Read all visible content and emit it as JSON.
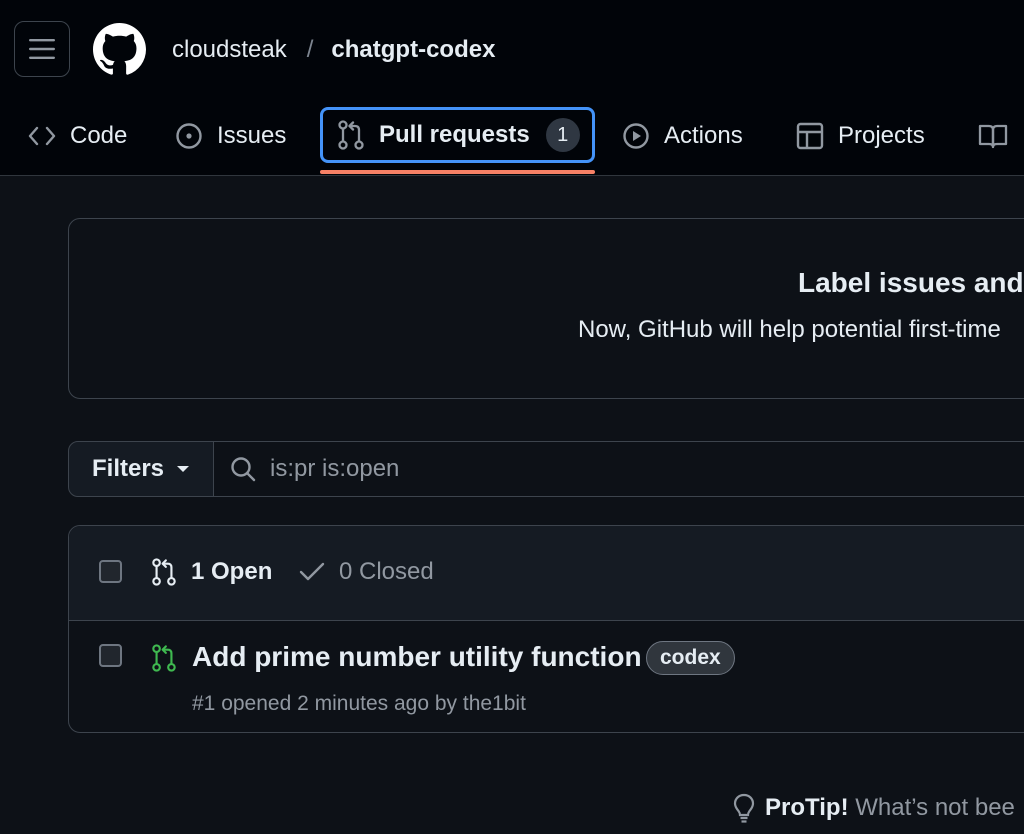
{
  "breadcrumb": {
    "owner": "cloudsteak",
    "separator": "/",
    "repo": "chatgpt-codex"
  },
  "tabs": [
    {
      "label": "Code",
      "icon": "code-icon"
    },
    {
      "label": "Issues",
      "icon": "issue-opened-icon"
    },
    {
      "label": "Pull requests",
      "icon": "git-pull-request-icon",
      "count": "1",
      "active": true
    },
    {
      "label": "Actions",
      "icon": "play-icon"
    },
    {
      "label": "Projects",
      "icon": "table-icon"
    },
    {
      "label": "",
      "icon": "book-icon"
    }
  ],
  "banner": {
    "title": "Label issues and",
    "text": "Now, GitHub will help potential first-time"
  },
  "filters": {
    "label": "Filters",
    "search_value": "is:pr is:open"
  },
  "states": {
    "open": "1 Open",
    "closed": "0 Closed"
  },
  "pull_requests": [
    {
      "title": "Add prime number utility function",
      "label": "codex",
      "meta": "#1 opened 2 minutes ago by the1bit"
    }
  ],
  "protip": {
    "bold": "ProTip!",
    "text": "What’s not bee"
  },
  "colors": {
    "accent": "#4493f8",
    "underline": "#f78166",
    "open_green": "#3fb950"
  }
}
